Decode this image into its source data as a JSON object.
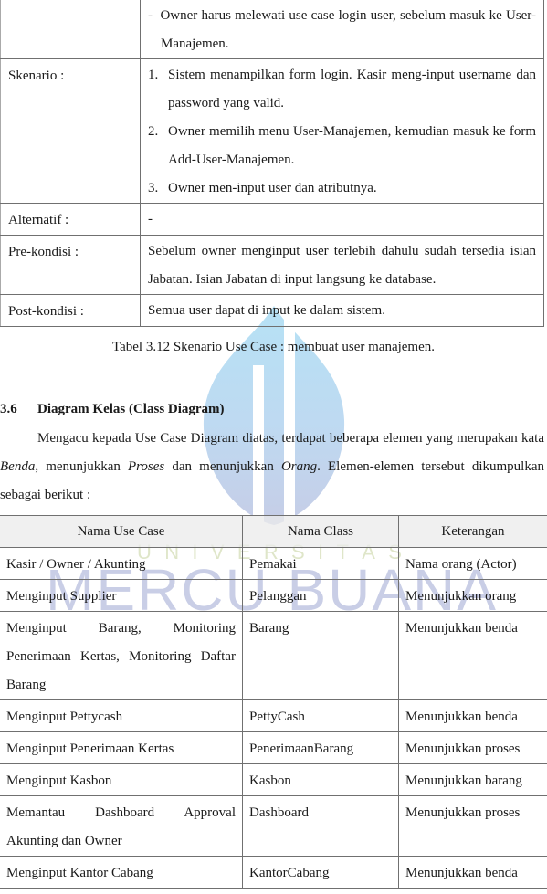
{
  "usecase_table": {
    "rows": [
      {
        "label": "",
        "dash_text": "Owner harus melewati use case login user, sebelum masuk ke User-Manajemen."
      },
      {
        "label": "Skenario :",
        "steps": [
          {
            "num": "1.",
            "text": "Sistem menampilkan form login. Kasir meng-input username dan password yang valid."
          },
          {
            "num": "2.",
            "text": "Owner memilih menu User-Manajemen, kemudian masuk ke form Add-User-Manajemen."
          },
          {
            "num": "3.",
            "text": "Owner men-input user dan atributnya."
          }
        ]
      },
      {
        "label": "Alternatif :",
        "value": "-"
      },
      {
        "label": "Pre-kondisi :",
        "value": "Sebelum owner menginput user terlebih dahulu sudah tersedia isian Jabatan. Isian Jabatan di input langsung ke database."
      },
      {
        "label": "Post-kondisi :",
        "value": "Semua user dapat di input ke dalam sistem."
      }
    ],
    "caption": "Tabel 3.12 Skenario Use Case :  membuat user manajemen."
  },
  "section": {
    "number": "3.6",
    "title": "Diagram Kelas (Class Diagram)",
    "paragraph": {
      "part1": "Mengacu kepada Use Case Diagram diatas, terdapat beberapa elemen yang merupakan kata ",
      "em1": "Benda",
      "part2": ", menunjukkan ",
      "em2": "Proses",
      "part3": " dan menunjukkan ",
      "em3": "Orang",
      "part4": ". Elemen-elemen tersebut dikumpulkan sebagai berikut :"
    }
  },
  "class_table": {
    "headers": [
      "Nama Use Case",
      "Nama Class",
      "Keterangan"
    ],
    "rows": [
      [
        "Kasir / Owner / Akunting",
        "Pemakai",
        "Nama orang (Actor)"
      ],
      [
        "Menginput Supplier",
        "Pelanggan",
        "Menunjukkan orang"
      ],
      [
        "Menginput Barang, Monitoring Penerimaan Kertas, Monitoring Daftar Barang",
        "Barang",
        "Menunjukkan benda"
      ],
      [
        "Menginput Pettycash",
        "PettyCash",
        "Menunjukkan benda"
      ],
      [
        "Menginput Penerimaan Kertas",
        "PenerimaanBarang",
        "Menunjukkan proses"
      ],
      [
        "Menginput Kasbon",
        "Kasbon",
        "Menunjukkan barang"
      ],
      [
        "Memantau Dashboard Approval Akunting dan Owner",
        "Dashboard",
        "Menunjukkan proses"
      ],
      [
        "Menginput Kantor Cabang",
        "KantorCabang",
        "Menunjukkan benda"
      ]
    ]
  },
  "watermark": {
    "line1": [
      "U",
      "N",
      "I",
      "V",
      "E",
      "R",
      "S",
      "I",
      "T",
      "A",
      "S"
    ],
    "line2": "MERCU BUANA",
    "colors": {
      "logo_top": "#a9dcf3",
      "logo_bottom": "#b8c2e0",
      "univ": "#dfe6c9",
      "mercu": "#c9cee6"
    }
  }
}
